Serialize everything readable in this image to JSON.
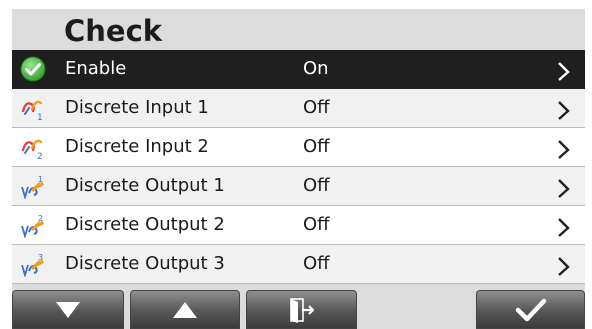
{
  "header": {
    "title": "Check"
  },
  "rows": [
    {
      "label": "Enable",
      "value": "On",
      "icon": "checkmark-circle-icon",
      "selected": true
    },
    {
      "label": "Discrete Input 1",
      "value": "Off",
      "icon": "discrete-input-1-icon"
    },
    {
      "label": "Discrete Input 2",
      "value": "Off",
      "icon": "discrete-input-2-icon"
    },
    {
      "label": "Discrete Output 1",
      "value": "Off",
      "icon": "discrete-output-1-icon"
    },
    {
      "label": "Discrete Output 2",
      "value": "Off",
      "icon": "discrete-output-2-icon"
    },
    {
      "label": "Discrete Output 3",
      "value": "Off",
      "icon": "discrete-output-3-icon"
    }
  ],
  "softkeys": [
    {
      "icon": "arrow-down-icon"
    },
    {
      "icon": "arrow-up-icon"
    },
    {
      "icon": "exit-door-icon"
    },
    {
      "icon": "checkmark-icon"
    }
  ],
  "colors": {
    "selected_row": "#1f1f1f",
    "panel": "#dcdcdc",
    "check_green": "#3dbb3a",
    "key_gradient_top": "#8f8f8f",
    "key_gradient_bottom": "#3c3c3c"
  }
}
